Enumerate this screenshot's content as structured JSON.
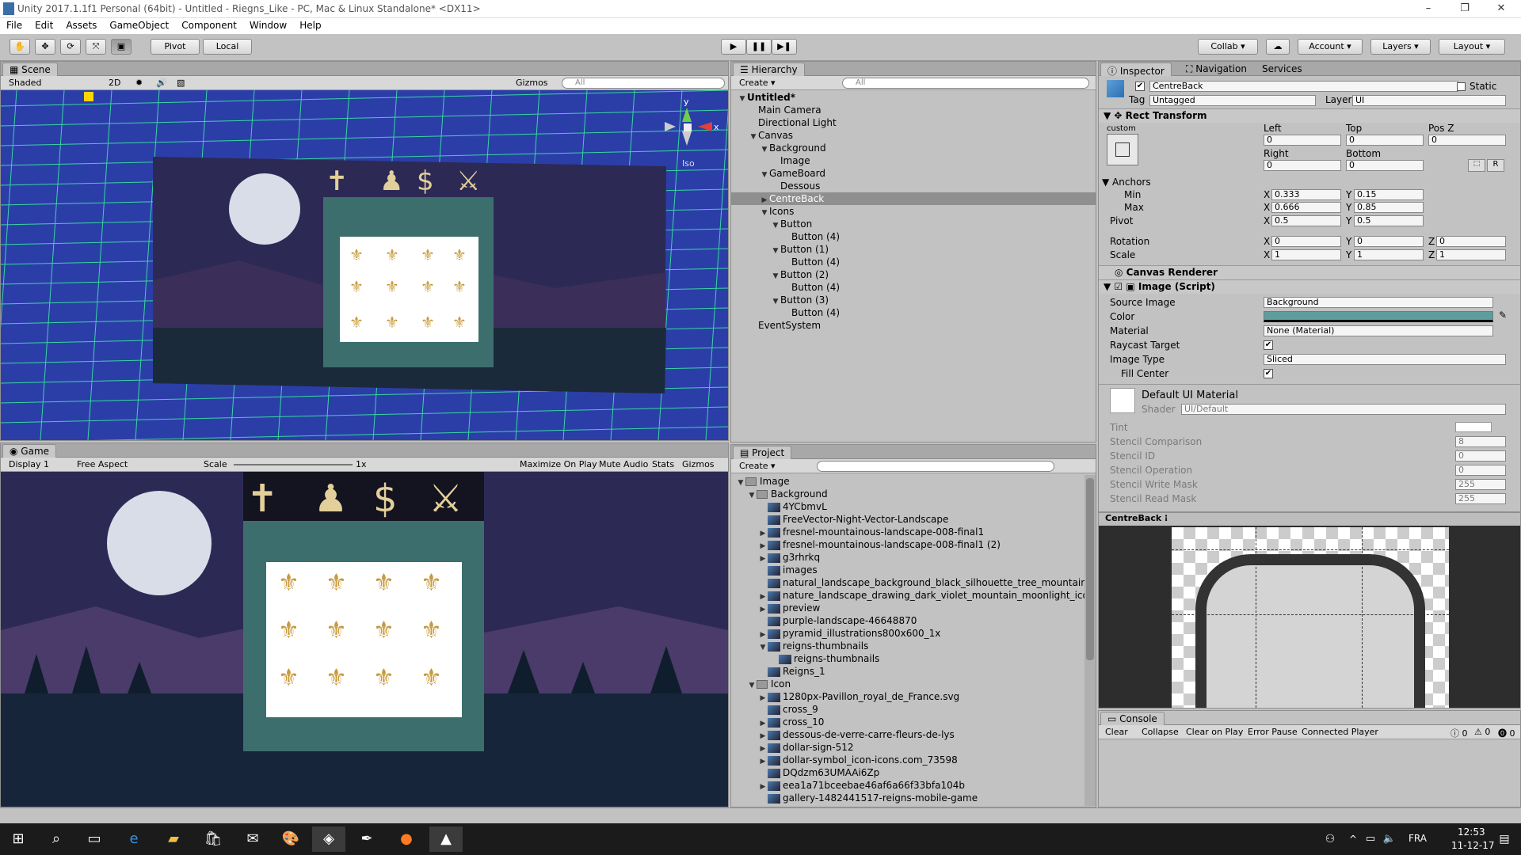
{
  "window": {
    "title": "Unity 2017.1.1f1 Personal (64bit) - Untitled - Riegns_Like - PC, Mac & Linux Standalone* <DX11>",
    "min": "–",
    "max": "❐",
    "close": "✕"
  },
  "menu": [
    "File",
    "Edit",
    "Assets",
    "GameObject",
    "Component",
    "Window",
    "Help"
  ],
  "toolbar": {
    "pivot": "Pivot",
    "local": "Local",
    "collab": "Collab",
    "account": "Account",
    "layers": "Layers",
    "layout": "Layout"
  },
  "scene": {
    "tab": "Scene",
    "shading": "Shaded",
    "mode2d": "2D",
    "gizmos": "Gizmos",
    "search": "All",
    "iso": "Iso",
    "axis_y": "y",
    "axis_x": "x"
  },
  "game": {
    "tab": "Game",
    "display": "Display 1",
    "aspect": "Free Aspect",
    "scale_label": "Scale",
    "scale_value": "1x",
    "maximize": "Maximize On Play",
    "mute": "Mute Audio",
    "stats": "Stats",
    "gizmos": "Gizmos"
  },
  "hierarchy": {
    "tab": "Hierarchy",
    "create": "Create",
    "search": "All",
    "items": [
      {
        "label": "Untitled*",
        "depth": 0,
        "open": true,
        "bold": true
      },
      {
        "label": "Main Camera",
        "depth": 1
      },
      {
        "label": "Directional Light",
        "depth": 1
      },
      {
        "label": "Canvas",
        "depth": 1,
        "open": true
      },
      {
        "label": "Background",
        "depth": 2,
        "open": true
      },
      {
        "label": "Image",
        "depth": 3
      },
      {
        "label": "GameBoard",
        "depth": 2,
        "open": true
      },
      {
        "label": "Dessous",
        "depth": 3
      },
      {
        "label": "CentreBack",
        "depth": 2,
        "closed": true,
        "selected": true
      },
      {
        "label": "Icons",
        "depth": 2,
        "open": true
      },
      {
        "label": "Button",
        "depth": 3,
        "open": true
      },
      {
        "label": "Button (4)",
        "depth": 4
      },
      {
        "label": "Button (1)",
        "depth": 3,
        "open": true
      },
      {
        "label": "Button (4)",
        "depth": 4
      },
      {
        "label": "Button (2)",
        "depth": 3,
        "open": true
      },
      {
        "label": "Button (4)",
        "depth": 4
      },
      {
        "label": "Button (3)",
        "depth": 3,
        "open": true
      },
      {
        "label": "Button (4)",
        "depth": 4
      },
      {
        "label": "EventSystem",
        "depth": 1
      }
    ]
  },
  "project": {
    "tab": "Project",
    "create": "Create",
    "items": [
      {
        "label": "Image",
        "depth": 0,
        "open": true,
        "folder": true
      },
      {
        "label": "Background",
        "depth": 1,
        "open": true,
        "folder": true
      },
      {
        "label": "4YCbmvL",
        "depth": 2
      },
      {
        "label": "FreeVector-Night-Vector-Landscape",
        "depth": 2
      },
      {
        "label": "fresnel-mountainous-landscape-008-final1",
        "depth": 2,
        "closed": true
      },
      {
        "label": "fresnel-mountainous-landscape-008-final1 (2)",
        "depth": 2,
        "closed": true
      },
      {
        "label": "g3rhrkq",
        "depth": 2,
        "closed": true
      },
      {
        "label": "images",
        "depth": 2
      },
      {
        "label": "natural_landscape_background_black_silhouette_tree_mountain_de",
        "depth": 2
      },
      {
        "label": "nature_landscape_drawing_dark_violet_mountain_moonlight_icon_",
        "depth": 2,
        "closed": true
      },
      {
        "label": "preview",
        "depth": 2,
        "closed": true
      },
      {
        "label": "purple-landscape-46648870",
        "depth": 2
      },
      {
        "label": "pyramid_illustrations800x600_1x",
        "depth": 2,
        "closed": true
      },
      {
        "label": "reigns-thumbnails",
        "depth": 2,
        "open": true
      },
      {
        "label": "reigns-thumbnails",
        "depth": 3
      },
      {
        "label": "Reigns_1",
        "depth": 2
      },
      {
        "label": "Icon",
        "depth": 1,
        "open": true,
        "folder": true
      },
      {
        "label": "1280px-Pavillon_royal_de_France.svg",
        "depth": 2,
        "closed": true
      },
      {
        "label": "cross_9",
        "depth": 2
      },
      {
        "label": "cross_10",
        "depth": 2,
        "closed": true
      },
      {
        "label": "dessous-de-verre-carre-fleurs-de-lys",
        "depth": 2,
        "closed": true
      },
      {
        "label": "dollar-sign-512",
        "depth": 2,
        "closed": true
      },
      {
        "label": "dollar-symbol_icon-icons.com_73598",
        "depth": 2,
        "closed": true
      },
      {
        "label": "DQdzm63UMAAi6Zp",
        "depth": 2
      },
      {
        "label": "eea1a71bceebae46af6a66f33bfa104b",
        "depth": 2,
        "closed": true
      },
      {
        "label": "gallery-1482441517-reigns-mobile-game",
        "depth": 2
      }
    ]
  },
  "inspector": {
    "tab": "Inspector",
    "tab2": "Navigation",
    "tab3": "Services",
    "name": "CentreBack",
    "static": "Static",
    "tag_label": "Tag",
    "tag": "Untagged",
    "layer_label": "Layer",
    "layer": "UI",
    "rect": {
      "title": "Rect Transform",
      "custom": "custom",
      "custom_v": "custom",
      "left": "Left",
      "top": "Top",
      "posz": "Pos Z",
      "left_v": "0",
      "top_v": "0",
      "posz_v": "0",
      "right": "Right",
      "bottom": "Bottom",
      "right_v": "0",
      "bottom_v": "0",
      "r": "R",
      "anchors": "Anchors",
      "min": "Min",
      "max": "Max",
      "pivot": "Pivot",
      "min_x": "0.333",
      "min_y": "0.15",
      "max_x": "0.666",
      "max_y": "0.85",
      "pivot_x": "0.5",
      "pivot_y": "0.5",
      "rotation": "Rotation",
      "scale": "Scale",
      "rot_x": "0",
      "rot_y": "0",
      "rot_z": "0",
      "sc_x": "1",
      "sc_y": "1",
      "sc_z": "1",
      "X": "X",
      "Y": "Y",
      "Z": "Z"
    },
    "canvas_renderer": "Canvas Renderer",
    "image": {
      "title": "Image (Script)",
      "source_label": "Source Image",
      "source": "Background",
      "color_label": "Color",
      "material_label": "Material",
      "material": "None (Material)",
      "raycast": "Raycast Target",
      "type_label": "Image Type",
      "type": "Sliced",
      "fill": "Fill Center"
    },
    "material": {
      "title": "Default UI Material",
      "shader_label": "Shader",
      "shader": "UI/Default",
      "tint": "Tint",
      "props": [
        {
          "k": "Stencil Comparison",
          "v": "8"
        },
        {
          "k": "Stencil ID",
          "v": "0"
        },
        {
          "k": "Stencil Operation",
          "v": "0"
        },
        {
          "k": "Stencil Write Mask",
          "v": "255"
        },
        {
          "k": "Stencil Read Mask",
          "v": "255"
        }
      ]
    },
    "preview_title": "CentreBack"
  },
  "console": {
    "tab": "Console",
    "clear": "Clear",
    "collapse": "Collapse",
    "clear_on_play": "Clear on Play",
    "error_pause": "Error Pause",
    "connected": "Connected Player",
    "c1": "0",
    "c2": "0",
    "c3": "0"
  },
  "taskbar": {
    "lang": "FRA",
    "time": "12:53",
    "date": "11-12-17"
  },
  "colors": {
    "scene_bg": "#2b3ea8",
    "grid": "#3df0a0",
    "teal": "#3c6e6e",
    "gold": "#c79a3c",
    "night": "#2c2a55"
  }
}
